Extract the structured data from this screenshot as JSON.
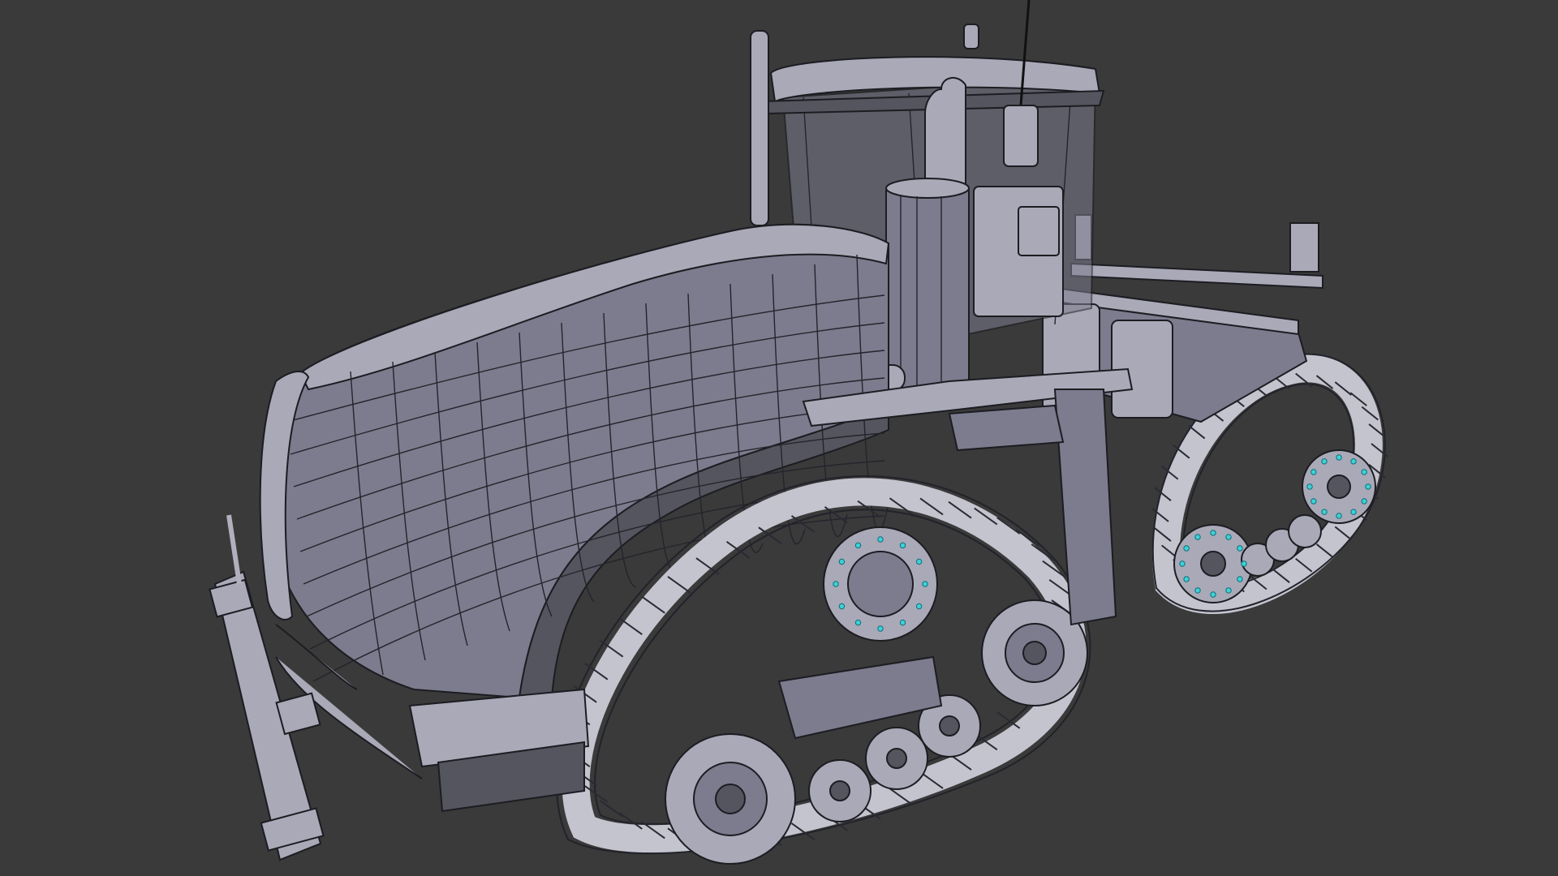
{
  "viewport": {
    "background": "#3a3a3a",
    "mode": "wireframe-on-shaded",
    "object": "tracked-tractor-mesh",
    "selection_color": "#3fd0d8"
  }
}
